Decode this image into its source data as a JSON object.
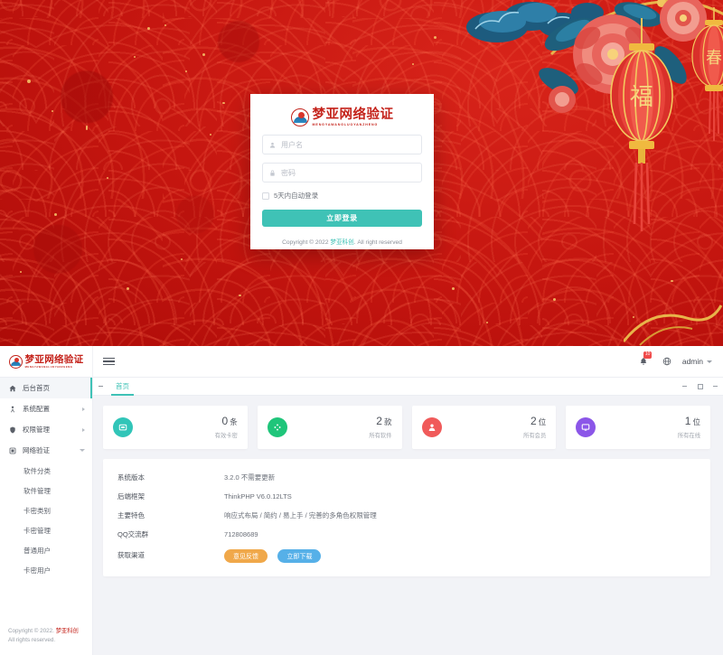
{
  "brand": {
    "title": "梦亚网络验证",
    "subtitle": "MENGYAWANGLUOYANZHENG"
  },
  "login": {
    "username_placeholder": "用户名",
    "password_placeholder": "密码",
    "username_value": "",
    "password_value": "",
    "remember_label": "5天内自动登录",
    "submit_label": "立即登录",
    "copyright_prefix": "Copyright © 2022 ",
    "copyright_brand": "梦亚科创",
    "copyright_suffix": ". All right reserved"
  },
  "header": {
    "user_label": "admin",
    "notification_count": "10",
    "bell_icon": "bell-icon",
    "globe_icon": "globe-icon",
    "menu_icon": "hamburger-icon"
  },
  "sidebar": {
    "items": [
      {
        "label": "后台首页",
        "icon": "home-icon",
        "active": true,
        "expandable": false
      },
      {
        "label": "系统配置",
        "icon": "person-gear-icon",
        "active": false,
        "expandable": true
      },
      {
        "label": "权限管理",
        "icon": "shield-user-icon",
        "active": false,
        "expandable": true
      },
      {
        "label": "网络验证",
        "icon": "network-shield-icon",
        "active": false,
        "expandable": true,
        "expanded": true
      }
    ],
    "submenu": [
      {
        "label": "软件分类"
      },
      {
        "label": "软件管理"
      },
      {
        "label": "卡密类别"
      },
      {
        "label": "卡密管理"
      },
      {
        "label": "普通用户"
      },
      {
        "label": "卡密用户"
      }
    ],
    "footer_prefix": "Copyright © 2022. ",
    "footer_brand": "梦亚科创",
    "footer_suffix": " All rights reserved."
  },
  "tabs": {
    "items": [
      {
        "label": "首页",
        "active": true
      }
    ]
  },
  "stats": [
    {
      "value": "0",
      "unit": "条",
      "label": "有效卡密",
      "color": "#31c5b8",
      "icon": "card-icon"
    },
    {
      "value": "2",
      "unit": "款",
      "label": "所有软件",
      "color": "#1fc57a",
      "icon": "software-icon"
    },
    {
      "value": "2",
      "unit": "位",
      "label": "所有会员",
      "color": "#f05a5a",
      "icon": "user-icon"
    },
    {
      "value": "1",
      "unit": "位",
      "label": "所有在线",
      "color": "#8b56e8",
      "icon": "monitor-icon"
    }
  ],
  "info": {
    "rows": [
      {
        "key": "系统版本",
        "value": "3.2.0 不需要更新"
      },
      {
        "key": "后端框架",
        "value": "ThinkPHP V6.0.12LTS"
      },
      {
        "key": "主要特色",
        "value": "响应式布局 / 简约 / 易上手 / 完善的多角色权限管理"
      },
      {
        "key": "QQ交流群",
        "value": "712808689"
      }
    ],
    "channel_key": "获取渠道",
    "buttons": [
      {
        "label": "意见反馈",
        "style": "warn"
      },
      {
        "label": "立即下载",
        "style": "info"
      }
    ]
  },
  "colors": {
    "accent": "#3fc2b6",
    "brand_red": "#c4221a",
    "bg_red": "#c71a13"
  }
}
